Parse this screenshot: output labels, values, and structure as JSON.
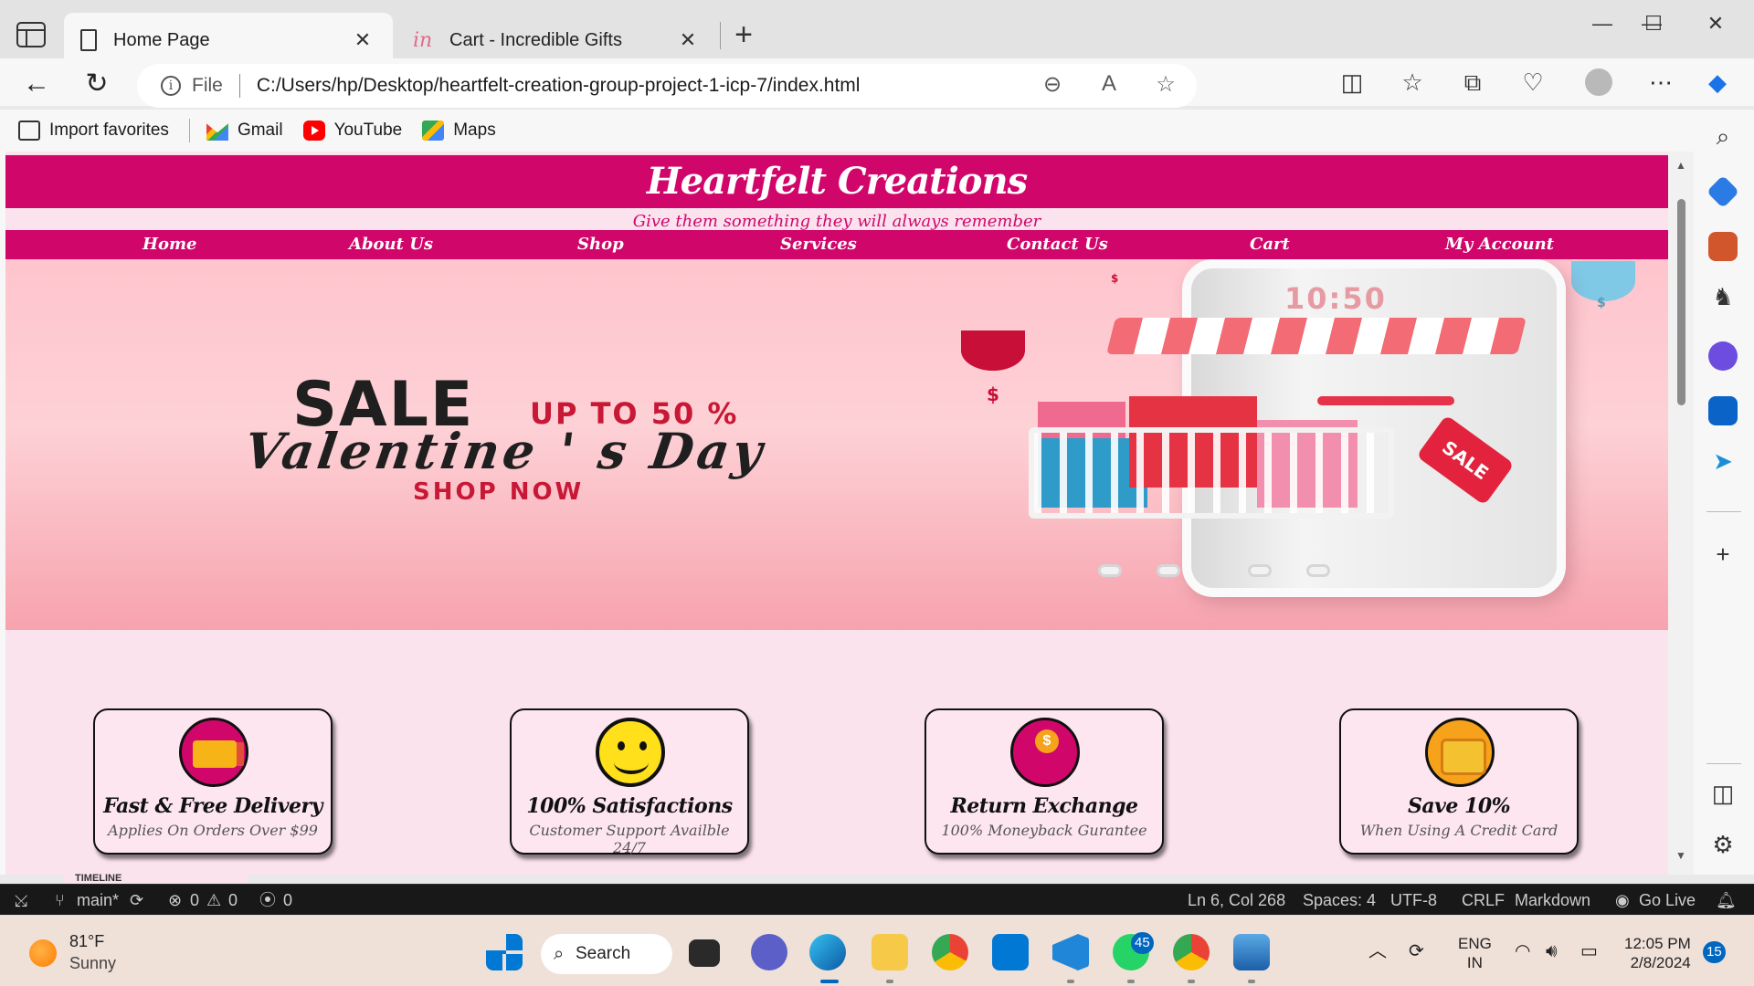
{
  "browser": {
    "tabs": [
      {
        "title": "Home Page",
        "active": true,
        "favicon": "document-icon"
      },
      {
        "title": "Cart - Incredible Gifts",
        "active": false,
        "favicon": "in-logo-icon"
      }
    ],
    "new_tab": "+",
    "window": {
      "minimize": "—",
      "maximize": "☐",
      "close": "✕"
    },
    "address": {
      "scheme": "File",
      "url": "C:/Users/hp/Desktop/heartfelt-creation-group-project-1-icp-7/index.html"
    },
    "bookmarks": [
      {
        "label": "Import favorites",
        "icon": "import-icon"
      },
      {
        "label": "Gmail",
        "icon": "gmail-icon"
      },
      {
        "label": "YouTube",
        "icon": "youtube-icon"
      },
      {
        "label": "Maps",
        "icon": "maps-icon"
      }
    ]
  },
  "site": {
    "title": "Heartfelt Creations",
    "tagline": "Give them something they will always remember",
    "nav": [
      "Home",
      "About Us",
      "Shop",
      "Services",
      "Contact Us",
      "Cart",
      "My Account"
    ],
    "brand_color": "#d1066b",
    "hero": {
      "sale": "SALE",
      "upto": "UP TO 50 %",
      "headline": "Valentine ' s Day",
      "cta": "SHOP NOW",
      "phone_time": "10:50",
      "tag": "SALE",
      "dollar": "$"
    },
    "features": [
      {
        "title": "Fast & Free Delivery",
        "subtitle": "Applies On Orders Over $99",
        "icon": "delivery-truck-icon"
      },
      {
        "title": "100% Satisfactions",
        "subtitle": "Customer Support Availble 24/7",
        "icon": "smiley-icon"
      },
      {
        "title": "Return Exchange",
        "subtitle": "100% Moneyback Gurantee",
        "icon": "money-hand-icon"
      },
      {
        "title": "Save 10%",
        "subtitle": "When Using A Credit Card",
        "icon": "wallet-icon"
      }
    ]
  },
  "vscode": {
    "peek": "TIMELINE",
    "branch": "main*",
    "errors": "0",
    "warnings": "0",
    "ports": "0",
    "position": "Ln 6, Col 268",
    "spaces": "Spaces: 4",
    "encoding": "UTF-8",
    "eol": "CRLF",
    "language": "Markdown",
    "golive": "Go Live"
  },
  "taskbar": {
    "weather_temp": "81°F",
    "weather_desc": "Sunny",
    "search": "Search",
    "whatsapp_badge": "45",
    "lang_top": "ENG",
    "lang_bottom": "IN",
    "time": "12:05 PM",
    "date": "2/8/2024",
    "notifications": "15"
  }
}
